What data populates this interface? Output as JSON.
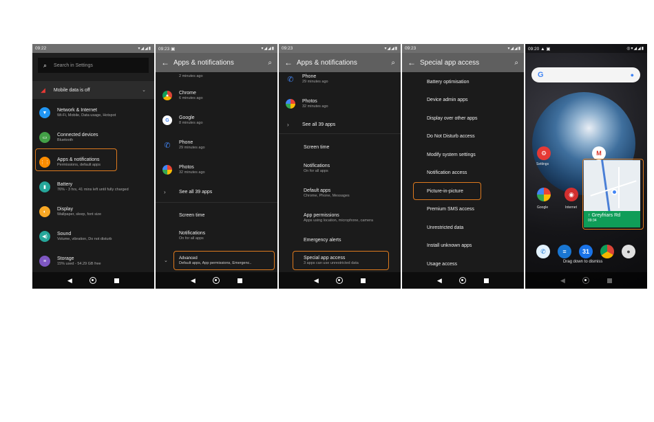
{
  "phone1": {
    "time": "09:22",
    "search_placeholder": "Search in Settings",
    "banner": "Mobile data is off",
    "items": [
      {
        "title": "Network & Internet",
        "sub": "Wi-Fi, Mobile, Data usage, Hotspot",
        "color": "#2196f3",
        "icon": "wifi-icon"
      },
      {
        "title": "Connected devices",
        "sub": "Bluetooth",
        "color": "#43a047",
        "icon": "devices-icon"
      },
      {
        "title": "Apps & notifications",
        "sub": "Permissions, default apps",
        "color": "#fb8c00",
        "icon": "apps-icon"
      },
      {
        "title": "Battery",
        "sub": "76% - 3 hrs, 41 mins left until fully charged",
        "color": "#26a69a",
        "icon": "battery-icon"
      },
      {
        "title": "Display",
        "sub": "Wallpaper, sleep, font size",
        "color": "#f9a825",
        "icon": "display-icon"
      },
      {
        "title": "Sound",
        "sub": "Volume, vibration, Do not disturb",
        "color": "#26a69a",
        "icon": "sound-icon"
      },
      {
        "title": "Storage",
        "sub": "15% used - 54.29 GB free",
        "color": "#7e57c2",
        "icon": "storage-icon"
      }
    ]
  },
  "phone2": {
    "time": "09:23",
    "title": "Apps & notifications",
    "top_partial_sub": "2 minutes ago",
    "apps": [
      {
        "name": "Chrome",
        "sub": "6 minutes ago",
        "icon": "chrome-icon"
      },
      {
        "name": "Google",
        "sub": "8 minutes ago",
        "icon": "google-icon"
      },
      {
        "name": "Phone",
        "sub": "29 minutes ago",
        "icon": "phone-icon"
      },
      {
        "name": "Photos",
        "sub": "32 minutes ago",
        "icon": "photos-icon"
      }
    ],
    "see_all": "See all 39 apps",
    "screen_time": "Screen time",
    "notifications": "Notifications",
    "notifications_sub": "On for all apps",
    "advanced": "Advanced",
    "advanced_sub": "Default apps, App permissions, Emergenc.."
  },
  "phone3": {
    "time": "09:23",
    "title": "Apps & notifications",
    "phone": "Phone",
    "phone_sub": "29 minutes ago",
    "photos": "Photos",
    "photos_sub": "32 minutes ago",
    "see_all": "See all 39 apps",
    "screen_time": "Screen time",
    "notifications": "Notifications",
    "notifications_sub": "On for all apps",
    "default_apps": "Default apps",
    "default_apps_sub": "Chrome, Phone, Messages",
    "app_permissions": "App permissions",
    "app_permissions_sub": "Apps using location, microphone, camera",
    "emergency": "Emergency alerts",
    "special": "Special app access",
    "special_sub": "3 apps can use unrestricted data"
  },
  "phone4": {
    "time": "09:23",
    "title": "Special app access",
    "items": [
      "Battery optimisation",
      "Device admin apps",
      "Display over other apps",
      "Do Not Disturb access",
      "Modify system settings",
      "Notification access",
      "Picture-in-picture",
      "Premium SMS access",
      "Unrestricted data",
      "Install unknown apps",
      "Usage access"
    ]
  },
  "phone5": {
    "time": "09:20",
    "settings_label": "Settings",
    "google_label": "Google",
    "internet_label": "Internet",
    "pip_street": "Greyfriars Rd",
    "pip_eta": "09:34",
    "drag_hint": "Drag down to dismiss"
  }
}
